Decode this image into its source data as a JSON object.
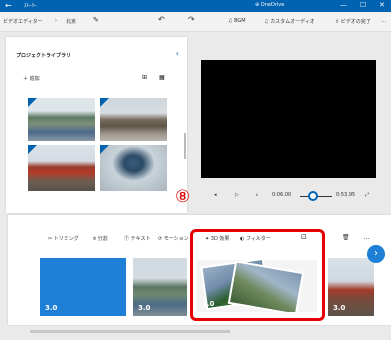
{
  "titlebar": {
    "back": "←",
    "app_name": "ｽﾄｰﾘｰ",
    "account": "⊕ OneDrive",
    "minimize": "—",
    "maximize": "☐",
    "close": "✕"
  },
  "toolbar": {
    "breadcrumb_root": "ビデオエディター",
    "breadcrumb_sep": "›",
    "project": "北京",
    "edit": "✎",
    "undo": "↶",
    "redo": "↷",
    "bgm": "♫ BGM",
    "custom_audio": "♫ カスタムオーディオ",
    "finish": "⇪ ビデオの完了",
    "more": "…"
  },
  "library": {
    "title": "プロジェクトライブラリ",
    "collapse": "‹",
    "add": "＋ 追加",
    "view_grid": "⊞",
    "view_list": "▦"
  },
  "player": {
    "prev": "◂",
    "play": "▷",
    "next": "▹",
    "current_time": "0:06.00",
    "total_time": "0:53.95",
    "fullscreen": "⤢"
  },
  "annotation": {
    "step": "⑧"
  },
  "timeline_tools": {
    "trim": "✂ トリミング",
    "split": "⫛ 分割",
    "text": "Ⓣ テキスト",
    "motion": "⟳ モーション",
    "effects_3d": "✦ 3D 効果",
    "filter": "◐ フィルター",
    "crop": "⊡",
    "delete": "🗑",
    "more": "…"
  },
  "timeline": {
    "clips": [
      {
        "duration": "3.0"
      },
      {
        "duration": "3.0"
      },
      {
        "duration": "3.0"
      },
      {
        "duration": "3.0"
      }
    ],
    "next": "›"
  }
}
